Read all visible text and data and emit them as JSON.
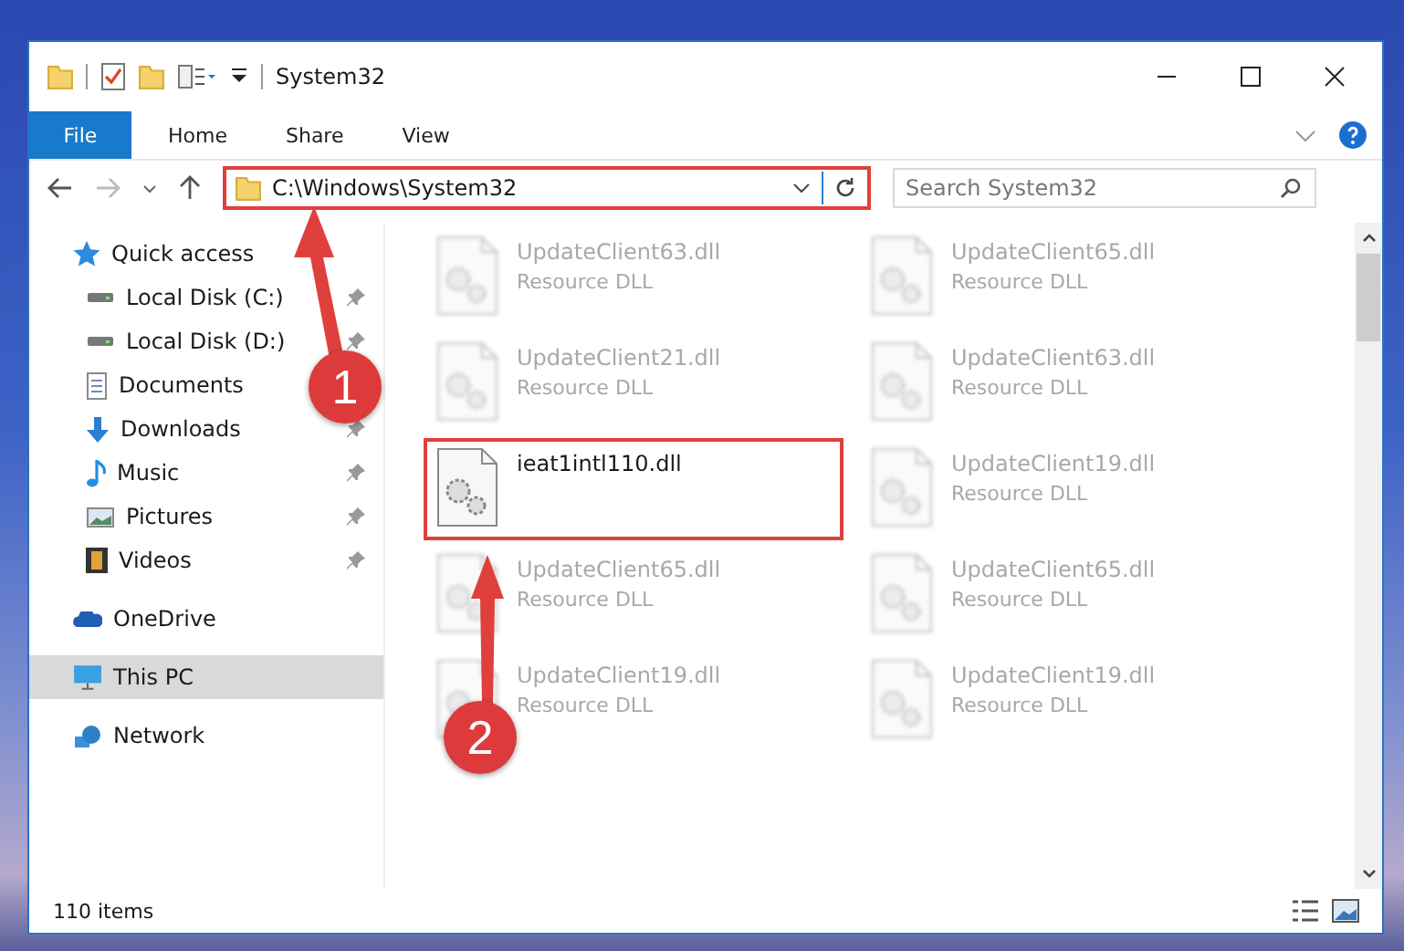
{
  "window": {
    "title": "System32"
  },
  "ribbon": {
    "tabs": [
      {
        "label": "File",
        "kind": "file"
      },
      {
        "label": "Home",
        "kind": "tab"
      },
      {
        "label": "Share",
        "kind": "tab"
      },
      {
        "label": "View",
        "kind": "tab"
      }
    ]
  },
  "address": {
    "path": "C:\\Windows\\System32",
    "highlighted": true
  },
  "search": {
    "placeholder": "Search System32"
  },
  "sidebar": {
    "items": [
      {
        "label": "Quick access",
        "kind": "star",
        "selected": false,
        "children": [
          {
            "label": "Local Disk (C:)",
            "kind": "disk",
            "pinned": true,
            "selected": false
          },
          {
            "label": "Local Disk (D:)",
            "kind": "disk",
            "pinned": true,
            "selected": false
          },
          {
            "label": "Documents",
            "kind": "documents",
            "selected": false
          },
          {
            "label": "Downloads",
            "kind": "downloads",
            "pinned": true,
            "selected": false
          },
          {
            "label": "Music",
            "kind": "music",
            "pinned": true,
            "selected": false
          },
          {
            "label": "Pictures",
            "kind": "pictures",
            "pinned": true,
            "selected": false
          },
          {
            "label": "Videos",
            "kind": "videos",
            "pinned": true,
            "selected": false
          }
        ]
      },
      {
        "label": "OneDrive",
        "kind": "cloud",
        "selected": false
      },
      {
        "label": "This PC",
        "kind": "pc",
        "selected": true
      },
      {
        "label": "Network",
        "kind": "network",
        "selected": false
      }
    ]
  },
  "files": [
    {
      "name": "UpdateClient63.dll",
      "type": "Resource DLL",
      "blurred": true,
      "highlighted": false
    },
    {
      "name": "UpdateClient65.dll",
      "type": "Resource DLL",
      "blurred": true,
      "highlighted": false
    },
    {
      "name": "UpdateClient21.dll",
      "type": "Resource DLL",
      "blurred": true,
      "highlighted": false
    },
    {
      "name": "UpdateClient63.dll",
      "type": "Resource DLL",
      "blurred": true,
      "highlighted": false
    },
    {
      "name": "ieat1intl110.dll",
      "blurred": false,
      "highlighted": true
    },
    {
      "name": "UpdateClient19.dll",
      "type": "Resource DLL",
      "blurred": true,
      "highlighted": false
    },
    {
      "name": "UpdateClient65.dll",
      "type": "Resource DLL",
      "blurred": true,
      "highlighted": false
    },
    {
      "name": "UpdateClient65.dll",
      "type": "Resource DLL",
      "blurred": true,
      "highlighted": false
    },
    {
      "name": "UpdateClient19.dll",
      "type": "Resource DLL",
      "blurred": true,
      "highlighted": false
    },
    {
      "name": "UpdateClient19.dll",
      "type": "Resource DLL",
      "blurred": true,
      "highlighted": false
    }
  ],
  "status_bar": {
    "item_count": "110 items"
  },
  "annotations": [
    {
      "label": "1"
    },
    {
      "label": "2"
    }
  ]
}
